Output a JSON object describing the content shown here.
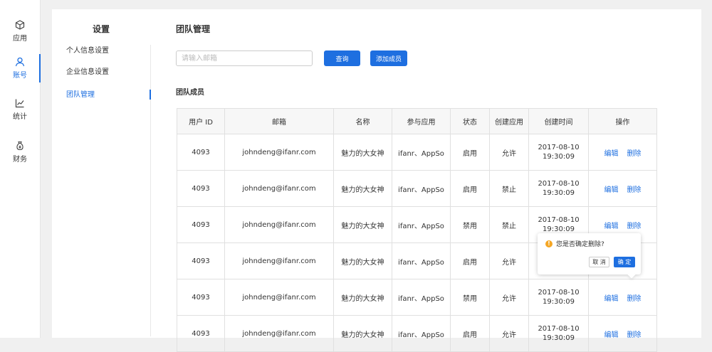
{
  "nav": {
    "items": [
      {
        "label": "应用",
        "icon": "cube-icon"
      },
      {
        "label": "账号",
        "icon": "user-icon",
        "active": true
      },
      {
        "label": "统计",
        "icon": "chart-icon"
      },
      {
        "label": "财务",
        "icon": "money-bag-icon"
      }
    ]
  },
  "settings": {
    "title": "设置",
    "items": [
      {
        "label": "个人信息设置"
      },
      {
        "label": "企业信息设置"
      },
      {
        "label": "团队管理",
        "active": true
      }
    ]
  },
  "main": {
    "title": "团队管理",
    "search_placeholder": "请输入邮箱",
    "query_button": "查询",
    "add_button": "添加成员",
    "section_title": "团队成员",
    "columns": [
      "用户 ID",
      "邮箱",
      "名称",
      "参与应用",
      "状态",
      "创建应用",
      "创建时间",
      "操作"
    ],
    "rows": [
      {
        "id": "4093",
        "email": "johndeng@ifanr.com",
        "name": "魅力的大女神",
        "apps": "ifanr、AppSo",
        "status": "启用",
        "create_app": "允许",
        "date": "2017-08-10",
        "time": "19:30:09",
        "edit": "编辑",
        "delete": "删除"
      },
      {
        "id": "4093",
        "email": "johndeng@ifanr.com",
        "name": "魅力的大女神",
        "apps": "ifanr、AppSo",
        "status": "启用",
        "create_app": "禁止",
        "date": "2017-08-10",
        "time": "19:30:09",
        "edit": "编辑",
        "delete": "删除"
      },
      {
        "id": "4093",
        "email": "johndeng@ifanr.com",
        "name": "魅力的大女神",
        "apps": "ifanr、AppSo",
        "status": "禁用",
        "create_app": "禁止",
        "date": "2017-08-10",
        "time": "19:30:09",
        "edit": "编辑",
        "delete": "删除"
      },
      {
        "id": "4093",
        "email": "johndeng@ifanr.com",
        "name": "魅力的大女神",
        "apps": "ifanr、AppSo",
        "status": "启用",
        "create_app": "允许",
        "date": "",
        "time": "",
        "edit": "",
        "delete": ""
      },
      {
        "id": "4093",
        "email": "johndeng@ifanr.com",
        "name": "魅力的大女神",
        "apps": "ifanr、AppSo",
        "status": "禁用",
        "create_app": "允许",
        "date": "2017-08-10",
        "time": "19:30:09",
        "edit": "编辑",
        "delete": "删除"
      },
      {
        "id": "4093",
        "email": "johndeng@ifanr.com",
        "name": "魅力的大女神",
        "apps": "ifanr、AppSo",
        "status": "启用",
        "create_app": "允许",
        "date": "2017-08-10",
        "time": "19:30:09",
        "edit": "编辑",
        "delete": "删除"
      }
    ]
  },
  "popconfirm": {
    "message": "您是否确定删除?",
    "icon": "warning-icon",
    "cancel": "取 消",
    "confirm": "确 定"
  },
  "colors": {
    "accent": "#1e6fe0",
    "warning": "#f5a623"
  }
}
